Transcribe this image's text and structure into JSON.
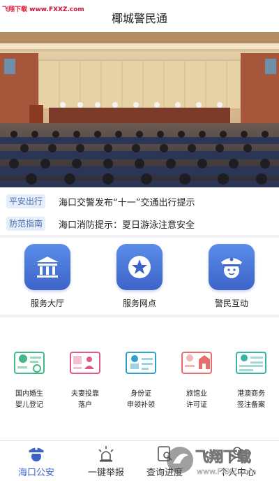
{
  "watermark": {
    "text": "飞翔下载",
    "url": "www.FXXZ.com"
  },
  "header": {
    "title": "椰城警民通"
  },
  "notices": [
    {
      "tag": "平安出行",
      "text": "海口交警发布“十一”交通出行提示"
    },
    {
      "tag": "防范指南",
      "text": "海口消防提示：夏日游泳注意安全"
    }
  ],
  "services": [
    {
      "label": "服务大厅",
      "icon": "bank-building-icon"
    },
    {
      "label": "服务网点",
      "icon": "star-icon"
    },
    {
      "label": "警民互动",
      "icon": "police-officer-icon"
    }
  ],
  "quick_items": [
    {
      "line1": "国内婚生",
      "line2": "婴儿登记",
      "icon": "birth-registration-card-icon",
      "color": "#45b88a"
    },
    {
      "line1": "夫妻投靠",
      "line2": "落户",
      "icon": "household-card-icon",
      "color": "#e0588a"
    },
    {
      "line1": "身份证",
      "line2": "申领补领",
      "icon": "id-card-icon",
      "color": "#2fa0c8"
    },
    {
      "line1": "旅馆业",
      "line2": "许可证",
      "icon": "hotel-permit-icon",
      "color": "#e56f6f"
    },
    {
      "line1": "港澳商务",
      "line2": "签注备案",
      "icon": "business-visa-icon",
      "color": "#3bb2a8"
    }
  ],
  "bottom_nav": [
    {
      "label": "海口公安",
      "icon": "police-badge-icon",
      "active": true
    },
    {
      "label": "一键举报",
      "icon": "alarm-light-icon",
      "active": false
    },
    {
      "label": "查询进度",
      "icon": "search-progress-icon",
      "active": false
    },
    {
      "label": "个人中心",
      "icon": "user-icon",
      "active": false
    }
  ],
  "logo_watermark": {
    "text": "飞翔下载",
    "url": "www.FXXZ.com"
  },
  "colors": {
    "accent": "#3a63c6",
    "tag_bg": "#e6eefa",
    "tag_text": "#4a6fb5"
  }
}
